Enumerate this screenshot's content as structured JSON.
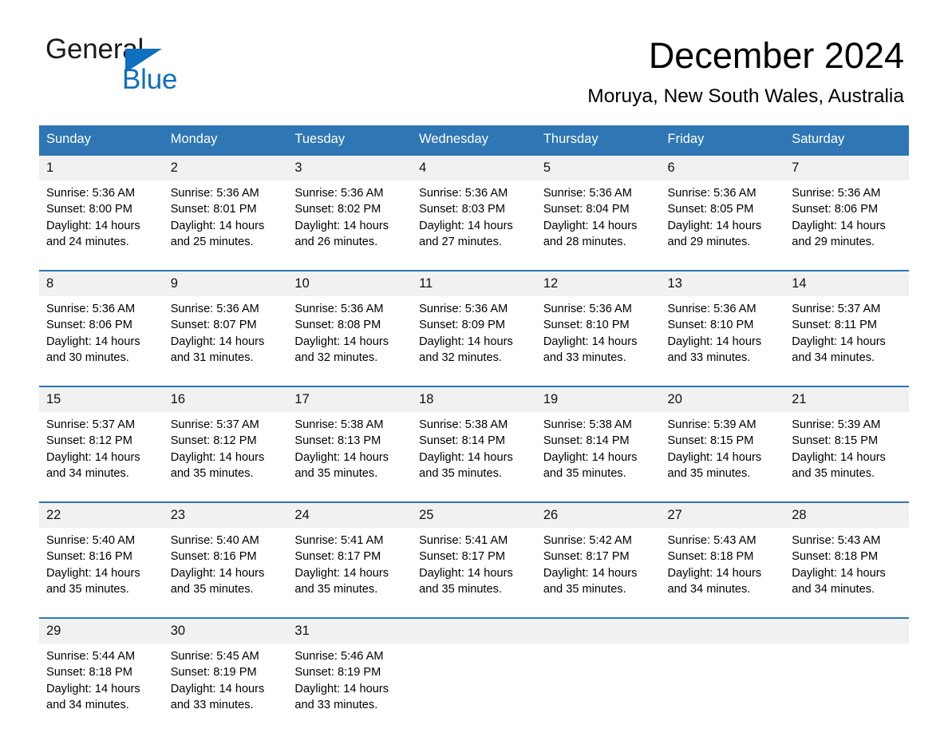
{
  "brand": {
    "name_part1": "General",
    "name_part2": "Blue",
    "triangle_icon": "blue-triangle-icon",
    "accent_color": "#0f6fc0"
  },
  "header": {
    "title": "December 2024",
    "location": "Moruya, New South Wales, Australia"
  },
  "theme": {
    "header_blue": "#2e76b4",
    "daynum_gray": "#f1f1f1"
  },
  "calendar": {
    "weekday_headers": [
      "Sunday",
      "Monday",
      "Tuesday",
      "Wednesday",
      "Thursday",
      "Friday",
      "Saturday"
    ],
    "weeks": [
      [
        {
          "day": "1",
          "sunrise": "Sunrise: 5:36 AM",
          "sunset": "Sunset: 8:00 PM",
          "daylight": "Daylight: 14 hours and 24 minutes."
        },
        {
          "day": "2",
          "sunrise": "Sunrise: 5:36 AM",
          "sunset": "Sunset: 8:01 PM",
          "daylight": "Daylight: 14 hours and 25 minutes."
        },
        {
          "day": "3",
          "sunrise": "Sunrise: 5:36 AM",
          "sunset": "Sunset: 8:02 PM",
          "daylight": "Daylight: 14 hours and 26 minutes."
        },
        {
          "day": "4",
          "sunrise": "Sunrise: 5:36 AM",
          "sunset": "Sunset: 8:03 PM",
          "daylight": "Daylight: 14 hours and 27 minutes."
        },
        {
          "day": "5",
          "sunrise": "Sunrise: 5:36 AM",
          "sunset": "Sunset: 8:04 PM",
          "daylight": "Daylight: 14 hours and 28 minutes."
        },
        {
          "day": "6",
          "sunrise": "Sunrise: 5:36 AM",
          "sunset": "Sunset: 8:05 PM",
          "daylight": "Daylight: 14 hours and 29 minutes."
        },
        {
          "day": "7",
          "sunrise": "Sunrise: 5:36 AM",
          "sunset": "Sunset: 8:06 PM",
          "daylight": "Daylight: 14 hours and 29 minutes."
        }
      ],
      [
        {
          "day": "8",
          "sunrise": "Sunrise: 5:36 AM",
          "sunset": "Sunset: 8:06 PM",
          "daylight": "Daylight: 14 hours and 30 minutes."
        },
        {
          "day": "9",
          "sunrise": "Sunrise: 5:36 AM",
          "sunset": "Sunset: 8:07 PM",
          "daylight": "Daylight: 14 hours and 31 minutes."
        },
        {
          "day": "10",
          "sunrise": "Sunrise: 5:36 AM",
          "sunset": "Sunset: 8:08 PM",
          "daylight": "Daylight: 14 hours and 32 minutes."
        },
        {
          "day": "11",
          "sunrise": "Sunrise: 5:36 AM",
          "sunset": "Sunset: 8:09 PM",
          "daylight": "Daylight: 14 hours and 32 minutes."
        },
        {
          "day": "12",
          "sunrise": "Sunrise: 5:36 AM",
          "sunset": "Sunset: 8:10 PM",
          "daylight": "Daylight: 14 hours and 33 minutes."
        },
        {
          "day": "13",
          "sunrise": "Sunrise: 5:36 AM",
          "sunset": "Sunset: 8:10 PM",
          "daylight": "Daylight: 14 hours and 33 minutes."
        },
        {
          "day": "14",
          "sunrise": "Sunrise: 5:37 AM",
          "sunset": "Sunset: 8:11 PM",
          "daylight": "Daylight: 14 hours and 34 minutes."
        }
      ],
      [
        {
          "day": "15",
          "sunrise": "Sunrise: 5:37 AM",
          "sunset": "Sunset: 8:12 PM",
          "daylight": "Daylight: 14 hours and 34 minutes."
        },
        {
          "day": "16",
          "sunrise": "Sunrise: 5:37 AM",
          "sunset": "Sunset: 8:12 PM",
          "daylight": "Daylight: 14 hours and 35 minutes."
        },
        {
          "day": "17",
          "sunrise": "Sunrise: 5:38 AM",
          "sunset": "Sunset: 8:13 PM",
          "daylight": "Daylight: 14 hours and 35 minutes."
        },
        {
          "day": "18",
          "sunrise": "Sunrise: 5:38 AM",
          "sunset": "Sunset: 8:14 PM",
          "daylight": "Daylight: 14 hours and 35 minutes."
        },
        {
          "day": "19",
          "sunrise": "Sunrise: 5:38 AM",
          "sunset": "Sunset: 8:14 PM",
          "daylight": "Daylight: 14 hours and 35 minutes."
        },
        {
          "day": "20",
          "sunrise": "Sunrise: 5:39 AM",
          "sunset": "Sunset: 8:15 PM",
          "daylight": "Daylight: 14 hours and 35 minutes."
        },
        {
          "day": "21",
          "sunrise": "Sunrise: 5:39 AM",
          "sunset": "Sunset: 8:15 PM",
          "daylight": "Daylight: 14 hours and 35 minutes."
        }
      ],
      [
        {
          "day": "22",
          "sunrise": "Sunrise: 5:40 AM",
          "sunset": "Sunset: 8:16 PM",
          "daylight": "Daylight: 14 hours and 35 minutes."
        },
        {
          "day": "23",
          "sunrise": "Sunrise: 5:40 AM",
          "sunset": "Sunset: 8:16 PM",
          "daylight": "Daylight: 14 hours and 35 minutes."
        },
        {
          "day": "24",
          "sunrise": "Sunrise: 5:41 AM",
          "sunset": "Sunset: 8:17 PM",
          "daylight": "Daylight: 14 hours and 35 minutes."
        },
        {
          "day": "25",
          "sunrise": "Sunrise: 5:41 AM",
          "sunset": "Sunset: 8:17 PM",
          "daylight": "Daylight: 14 hours and 35 minutes."
        },
        {
          "day": "26",
          "sunrise": "Sunrise: 5:42 AM",
          "sunset": "Sunset: 8:17 PM",
          "daylight": "Daylight: 14 hours and 35 minutes."
        },
        {
          "day": "27",
          "sunrise": "Sunrise: 5:43 AM",
          "sunset": "Sunset: 8:18 PM",
          "daylight": "Daylight: 14 hours and 34 minutes."
        },
        {
          "day": "28",
          "sunrise": "Sunrise: 5:43 AM",
          "sunset": "Sunset: 8:18 PM",
          "daylight": "Daylight: 14 hours and 34 minutes."
        }
      ],
      [
        {
          "day": "29",
          "sunrise": "Sunrise: 5:44 AM",
          "sunset": "Sunset: 8:18 PM",
          "daylight": "Daylight: 14 hours and 34 minutes."
        },
        {
          "day": "30",
          "sunrise": "Sunrise: 5:45 AM",
          "sunset": "Sunset: 8:19 PM",
          "daylight": "Daylight: 14 hours and 33 minutes."
        },
        {
          "day": "31",
          "sunrise": "Sunrise: 5:46 AM",
          "sunset": "Sunset: 8:19 PM",
          "daylight": "Daylight: 14 hours and 33 minutes."
        },
        {
          "day": "",
          "sunrise": "",
          "sunset": "",
          "daylight": ""
        },
        {
          "day": "",
          "sunrise": "",
          "sunset": "",
          "daylight": ""
        },
        {
          "day": "",
          "sunrise": "",
          "sunset": "",
          "daylight": ""
        },
        {
          "day": "",
          "sunrise": "",
          "sunset": "",
          "daylight": ""
        }
      ]
    ]
  }
}
